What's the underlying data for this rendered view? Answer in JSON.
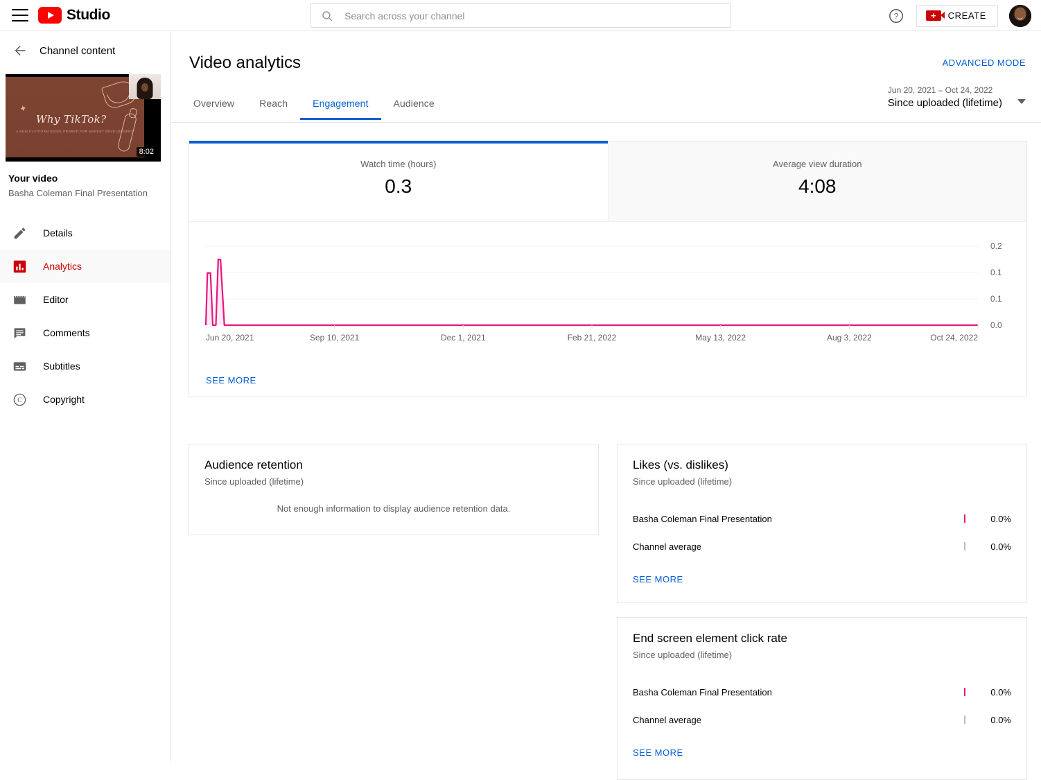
{
  "topbar": {
    "menu_icon": "hamburger-icon",
    "brand": "Studio",
    "search_placeholder": "Search across your channel",
    "search_value": "",
    "help_icon": "help-circle-icon",
    "create_label": "CREATE",
    "create_icon": "video-camera-plus-icon",
    "avatar": "channel-avatar"
  },
  "sidebar": {
    "back_label": "Channel content",
    "thumbnail": {
      "title": "Why TikTok?",
      "subtitle": "A NEW PLATFORM BEING PROBED FOR MARKET DEVELOPMENT",
      "duration": "8:02"
    },
    "your_video_label": "Your video",
    "video_title": "Basha Coleman Final Presentation",
    "items": [
      {
        "label": "Details",
        "icon": "pencil-icon",
        "active": false
      },
      {
        "label": "Analytics",
        "icon": "bar-chart-icon",
        "active": true
      },
      {
        "label": "Editor",
        "icon": "clapboard-icon",
        "active": false
      },
      {
        "label": "Comments",
        "icon": "comment-icon",
        "active": false
      },
      {
        "label": "Subtitles",
        "icon": "subtitles-icon",
        "active": false
      },
      {
        "label": "Copyright",
        "icon": "copyright-icon",
        "active": false
      }
    ]
  },
  "main": {
    "page_title": "Video analytics",
    "advanced_mode": "ADVANCED MODE",
    "tabs": [
      {
        "label": "Overview",
        "active": false
      },
      {
        "label": "Reach",
        "active": false
      },
      {
        "label": "Engagement",
        "active": true
      },
      {
        "label": "Audience",
        "active": false
      }
    ],
    "date_range": {
      "range": "Jun 20, 2021 – Oct 24, 2022",
      "preset": "Since uploaded (lifetime)"
    },
    "metrics": [
      {
        "label": "Watch time (hours)",
        "value": "0.3",
        "selected": true
      },
      {
        "label": "Average view duration",
        "value": "4:08",
        "selected": false
      }
    ],
    "see_more": "SEE MORE"
  },
  "cards": {
    "audience_retention": {
      "title": "Audience retention",
      "subtitle": "Since uploaded (lifetime)",
      "empty_message": "Not enough information to display audience retention data."
    },
    "likes": {
      "title": "Likes (vs. dislikes)",
      "subtitle": "Since uploaded (lifetime)",
      "see_more": "SEE MORE",
      "rows": [
        {
          "name": "Basha Coleman Final Presentation",
          "value": "0.0%",
          "color": "#e5177f"
        },
        {
          "name": "Channel average",
          "value": "0.0%",
          "color": "#bdbdbd"
        }
      ]
    },
    "end_screen": {
      "title": "End screen element click rate",
      "subtitle": "Since uploaded (lifetime)",
      "see_more": "SEE MORE",
      "rows": [
        {
          "name": "Basha Coleman Final Presentation",
          "value": "0.0%",
          "color": "#e5177f"
        },
        {
          "name": "Channel average",
          "value": "0.0%",
          "color": "#bdbdbd"
        }
      ]
    }
  },
  "chart_data": {
    "type": "line",
    "title": "Watch time (hours)",
    "xlabel": "",
    "ylabel": "Watch time (hours)",
    "series_name": "Watch time (hours)",
    "line_color": "#e5177f",
    "fill_color": "#fdeaf4",
    "grid": true,
    "legend": "none",
    "ylim": [
      0,
      0.2
    ],
    "yticks": [
      0.2,
      0.1,
      0.1,
      0.0
    ],
    "ytick_labels": [
      "0.2",
      "0.1",
      "0.1",
      "0.0"
    ],
    "xticks": [
      "Jun 20, 2021",
      "Sep 10, 2021",
      "Dec 1, 2021",
      "Feb 21, 2022",
      "May 13, 2022",
      "Aug 3, 2022",
      "Oct 24, 2022"
    ],
    "x_start": "Jun 20, 2021",
    "x_end": "Oct 24, 2022",
    "points": [
      {
        "x": 0.0,
        "y": 0.0
      },
      {
        "x": 0.002,
        "y": 0.132
      },
      {
        "x": 0.006,
        "y": 0.132
      },
      {
        "x": 0.009,
        "y": 0.0
      },
      {
        "x": 0.013,
        "y": 0.0
      },
      {
        "x": 0.016,
        "y": 0.166
      },
      {
        "x": 0.019,
        "y": 0.166
      },
      {
        "x": 0.024,
        "y": 0.0
      },
      {
        "x": 0.12,
        "y": 0.0
      },
      {
        "x": 0.4,
        "y": 0.0
      },
      {
        "x": 0.7,
        "y": 0.0
      },
      {
        "x": 1.0,
        "y": 0.0
      }
    ]
  }
}
